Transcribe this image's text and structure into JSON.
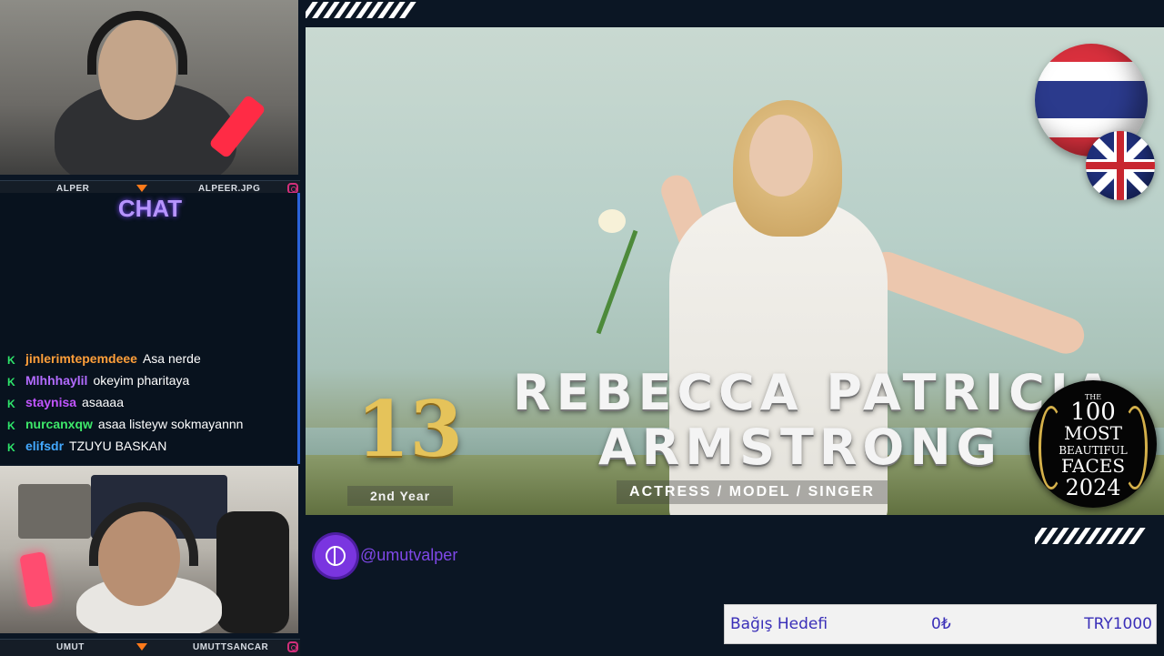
{
  "cams": {
    "top": {
      "left_name": "ALPER",
      "right_name": "ALPEER.JPG"
    },
    "bottom": {
      "left_name": "UMUT",
      "right_name": "UMUTTSANCAR"
    }
  },
  "chat": {
    "title": "CHAT",
    "messages": [
      {
        "user": "jinlerimtepemdeee",
        "user_color": "#ff9f3a",
        "text": "Asa nerde"
      },
      {
        "user": "Mlhhhaylil",
        "user_color": "#b26bff",
        "text": "okeyim pharitaya"
      },
      {
        "user": "staynisa",
        "user_color": "#c255ff",
        "text": "asaaaa"
      },
      {
        "user": "nurcanxqw",
        "user_color": "#3ee86a",
        "text": "asaa listeyw sokmayannn"
      },
      {
        "user": "elifsdr",
        "user_color": "#43a9ff",
        "text": "TZUYU BASKAN"
      }
    ]
  },
  "video": {
    "name_line1": "REBECCA PATRICIA",
    "name_line2": "ARMSTRONG",
    "rank": "13",
    "year_label": "2nd Year",
    "roles": "ACTRESS / MODEL / SINGER",
    "badge": {
      "the": "THE",
      "hundred": "100",
      "most": "MOST",
      "beautiful": "BEAUTIFUL",
      "faces": "FACES",
      "year": "2024"
    }
  },
  "social": {
    "handle": "@umutvalper",
    "icon": "globe-icon"
  },
  "donation": {
    "label": "Bağış Hedefi",
    "current": "0₺",
    "goal": "TRY1000"
  }
}
